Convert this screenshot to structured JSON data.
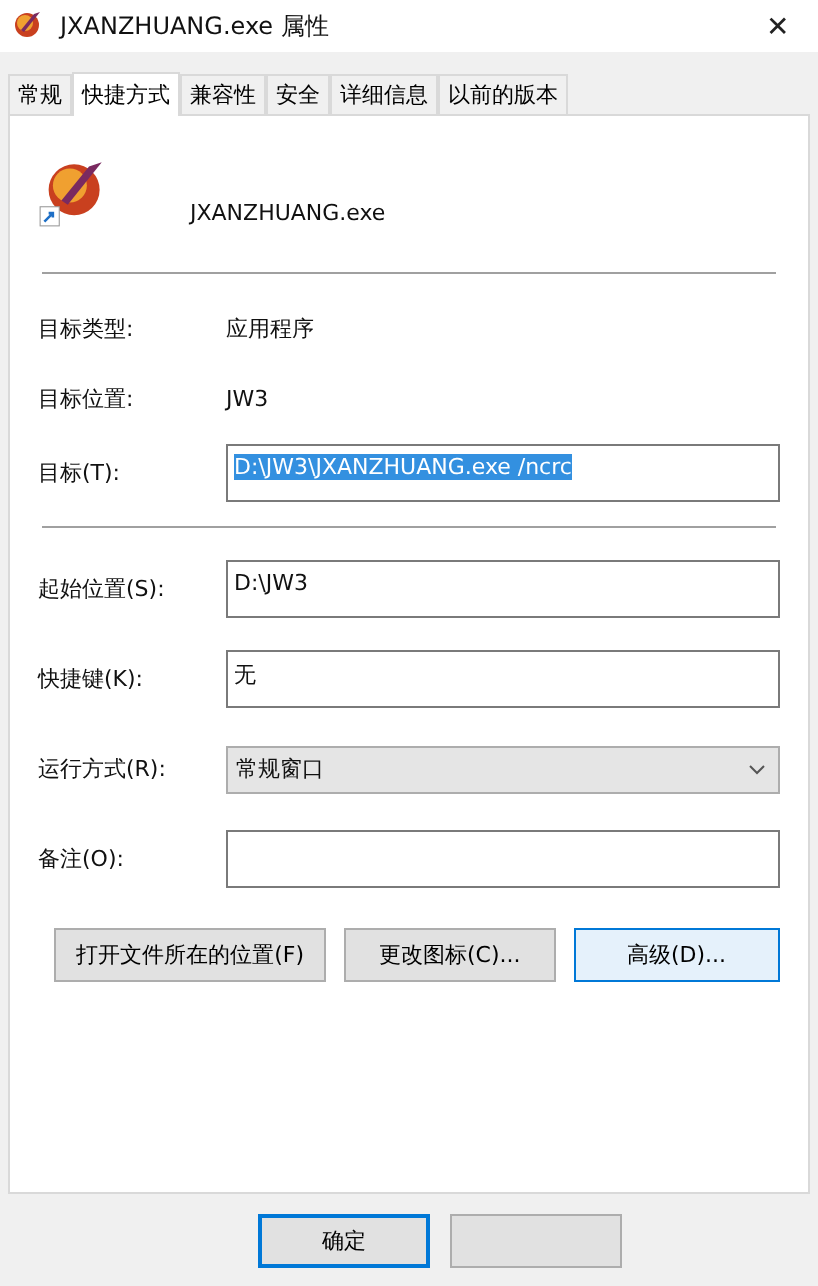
{
  "window": {
    "title": "JXANZHUANG.exe 属性",
    "close": "✕"
  },
  "tabs": [
    {
      "label": "常规",
      "selected": false
    },
    {
      "label": "快捷方式",
      "selected": true
    },
    {
      "label": "兼容性",
      "selected": false
    },
    {
      "label": "安全",
      "selected": false
    },
    {
      "label": "详细信息",
      "selected": false
    },
    {
      "label": "以前的版本",
      "selected": false
    }
  ],
  "file_name": "JXANZHUANG.exe",
  "info": [
    {
      "label": "目标类型:",
      "value": "应用程序"
    },
    {
      "label": "目标位置:",
      "value": "JW3"
    }
  ],
  "target": {
    "label": "目标(T):",
    "value": "D:\\JW3\\JXANZHUANG.exe /ncrc",
    "selected_text": true
  },
  "fields": [
    {
      "kind": "text",
      "label": "起始位置(S):",
      "value": "D:\\JW3"
    },
    {
      "kind": "text",
      "label": "快捷键(K):",
      "value": "无"
    },
    {
      "kind": "select",
      "label": "运行方式(R):",
      "value": "常规窗口"
    },
    {
      "kind": "text",
      "label": "备注(O):"
    }
  ],
  "actions": [
    {
      "label": "打开文件所在的位置(F)",
      "hovered": false
    },
    {
      "label": "更改图标(C)...",
      "hovered": false
    },
    {
      "label": "高级(D)...",
      "hovered": true
    }
  ],
  "footer_buttons": [
    {
      "label": "确定",
      "default": true
    },
    {
      "default": false
    }
  ]
}
